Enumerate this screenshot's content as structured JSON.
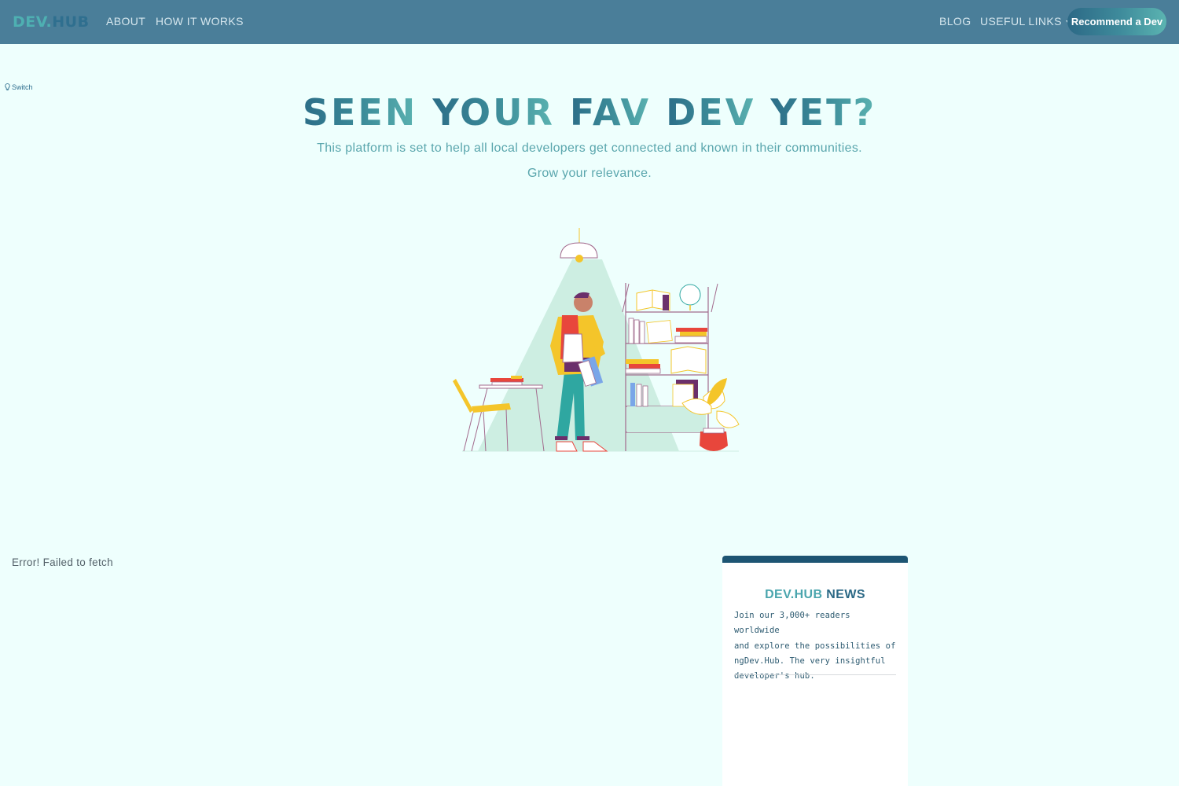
{
  "navbar": {
    "brand_part1": "DEV.",
    "brand_part2": "HUB",
    "links": {
      "about": "ABOUT",
      "how_it_works": "HOW IT WORKS",
      "blog": "BLOG",
      "useful_links": "USEFUL LINKS"
    },
    "cta_label": "Recommend a Dev"
  },
  "switch": {
    "label": "Switch",
    "icon": "lightbulb-icon"
  },
  "hero": {
    "title_words": [
      "SEEN",
      "YOUR",
      "FAV",
      "DEV",
      "YET?"
    ],
    "subtitle": "This platform is set to help all local developers get connected and known in their communities.",
    "subtitle2": "Grow your relevance."
  },
  "main": {
    "error_text": "Error! Failed to fetch"
  },
  "news_card": {
    "title_part1": "DEV.HUB",
    "title_part2": "NEWS",
    "body_lines": [
      "Join our 3,000+ readers worldwide",
      "and explore the possibilities of",
      "ngDev.Hub. The very insightful",
      "developer's hub."
    ]
  },
  "colors": {
    "navbar": "#4a7e99",
    "background": "#eefffd",
    "accent": "#5bb4b1",
    "card_top": "#1d5573"
  }
}
